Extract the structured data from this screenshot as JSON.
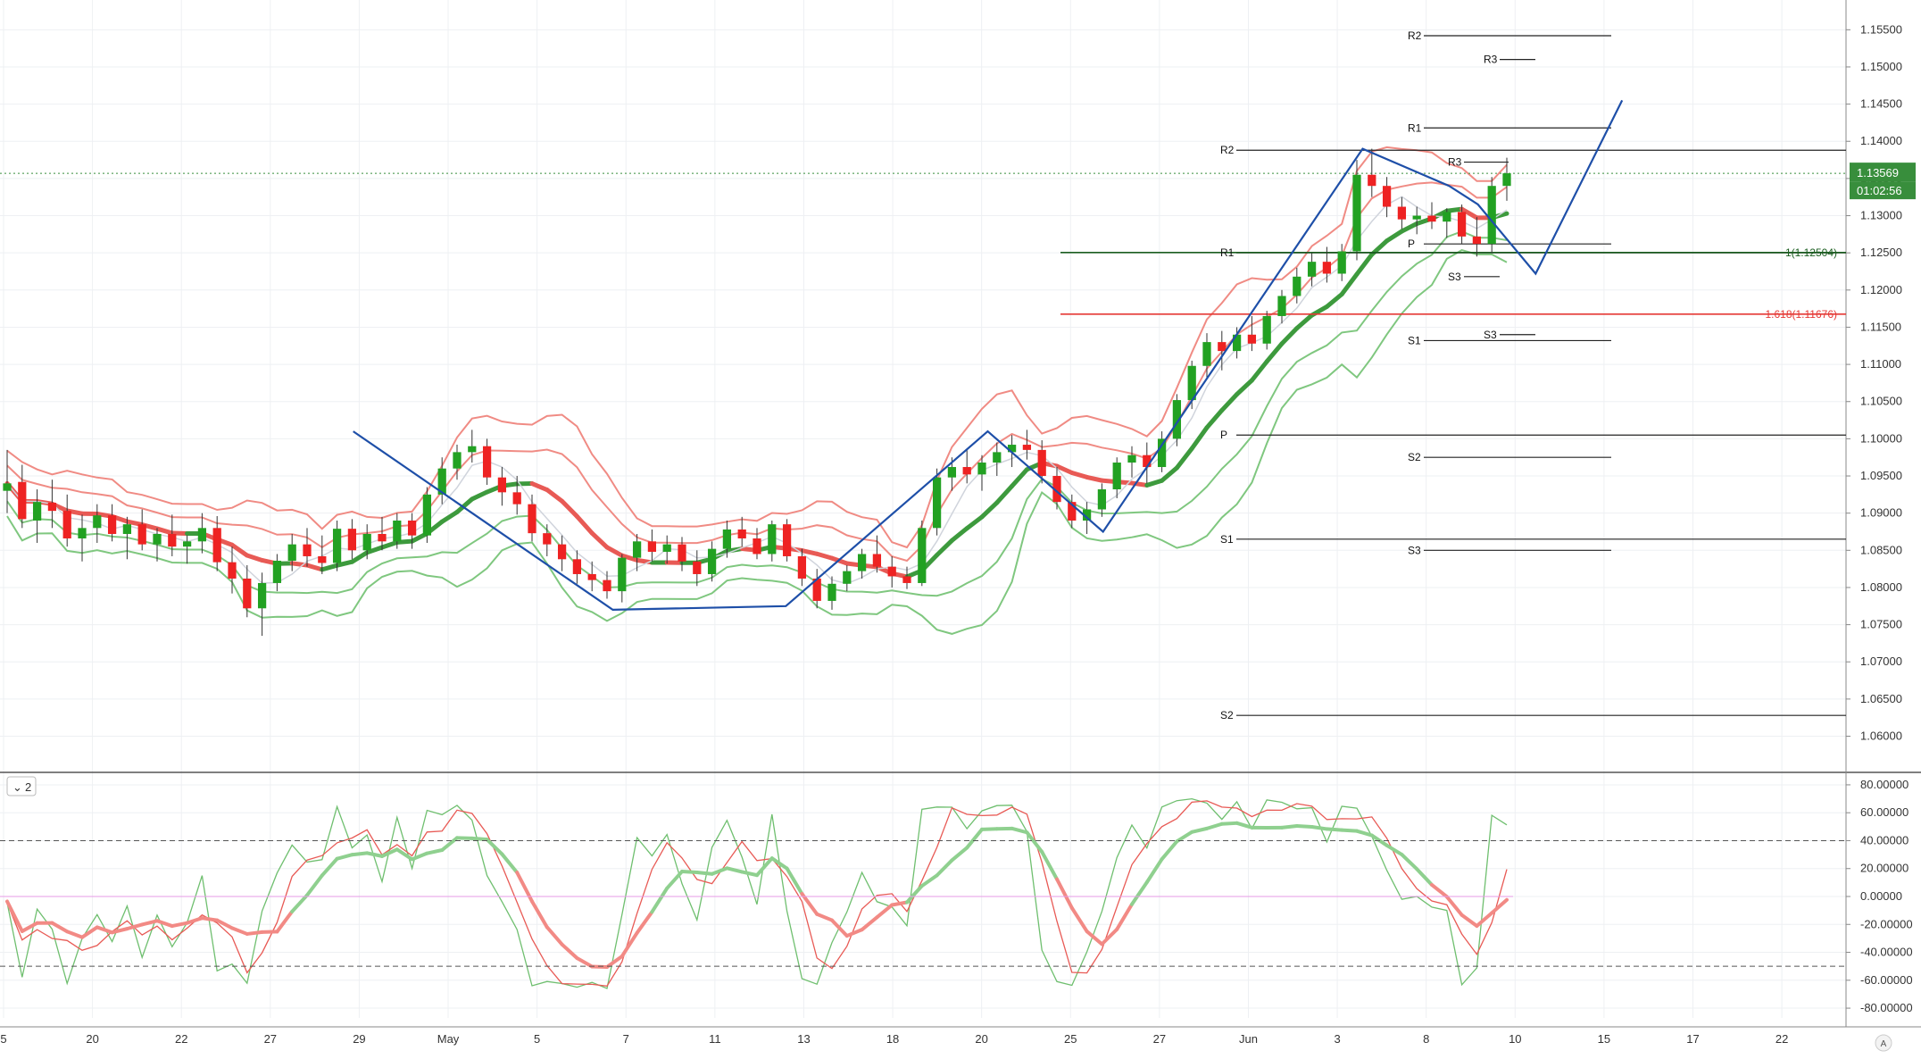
{
  "chart_data": {
    "type": "candlestick",
    "symbol_price": {
      "current_price": "1.13569",
      "countdown": "01:02:56",
      "price_color": "#388e3c",
      "value": 1.13569
    },
    "x_axis": {
      "tick_labels": [
        "5",
        "20",
        "22",
        "27",
        "29",
        "May",
        "5",
        "7",
        "11",
        "13",
        "18",
        "20",
        "25",
        "27",
        "Jun",
        "3",
        "8",
        "10",
        "15",
        "17",
        "22"
      ]
    },
    "price_pane": {
      "ylim": [
        1.0555,
        1.159
      ],
      "y_ticks": [
        1.06,
        1.065,
        1.07,
        1.075,
        1.08,
        1.085,
        1.09,
        1.095,
        1.1,
        1.105,
        1.11,
        1.115,
        1.12,
        1.125,
        1.13,
        1.135,
        1.14,
        1.145,
        1.15,
        1.155
      ],
      "y_tick_labels": [
        "1.06000",
        "1.06500",
        "1.07000",
        "1.07500",
        "1.08000",
        "1.08500",
        "1.09000",
        "1.09500",
        "1.10000",
        "1.10500",
        "1.11000",
        "1.11500",
        "1.12000",
        "1.12500",
        "1.13000",
        "1.13500",
        "1.14000",
        "1.14500",
        "1.15000",
        "1.15500"
      ],
      "candles": [
        {
          "o": 1.093,
          "h": 1.0985,
          "l": 1.09,
          "c": 1.094
        },
        {
          "o": 1.0942,
          "h": 1.0965,
          "l": 1.088,
          "c": 1.0892
        },
        {
          "o": 1.089,
          "h": 1.0932,
          "l": 1.086,
          "c": 1.0915
        },
        {
          "o": 1.0914,
          "h": 1.0945,
          "l": 1.088,
          "c": 1.0903
        },
        {
          "o": 1.0903,
          "h": 1.0925,
          "l": 1.0855,
          "c": 1.0866
        },
        {
          "o": 1.0866,
          "h": 1.0898,
          "l": 1.0835,
          "c": 1.088
        },
        {
          "o": 1.088,
          "h": 1.0912,
          "l": 1.086,
          "c": 1.0897
        },
        {
          "o": 1.0897,
          "h": 1.0912,
          "l": 1.0862,
          "c": 1.0872
        },
        {
          "o": 1.0872,
          "h": 1.0895,
          "l": 1.0838,
          "c": 1.0885
        },
        {
          "o": 1.0885,
          "h": 1.0905,
          "l": 1.085,
          "c": 1.0858
        },
        {
          "o": 1.0858,
          "h": 1.088,
          "l": 1.0835,
          "c": 1.0872
        },
        {
          "o": 1.0872,
          "h": 1.0898,
          "l": 1.0842,
          "c": 1.0855
        },
        {
          "o": 1.0855,
          "h": 1.087,
          "l": 1.0832,
          "c": 1.0862
        },
        {
          "o": 1.0862,
          "h": 1.09,
          "l": 1.0846,
          "c": 1.088
        },
        {
          "o": 1.088,
          "h": 1.0896,
          "l": 1.0822,
          "c": 1.0834
        },
        {
          "o": 1.0834,
          "h": 1.0855,
          "l": 1.0792,
          "c": 1.0812
        },
        {
          "o": 1.0812,
          "h": 1.083,
          "l": 1.076,
          "c": 1.0772
        },
        {
          "o": 1.0772,
          "h": 1.082,
          "l": 1.0735,
          "c": 1.0806
        },
        {
          "o": 1.0806,
          "h": 1.0845,
          "l": 1.0795,
          "c": 1.0836
        },
        {
          "o": 1.0836,
          "h": 1.0872,
          "l": 1.0822,
          "c": 1.0858
        },
        {
          "o": 1.0858,
          "h": 1.088,
          "l": 1.0828,
          "c": 1.0842
        },
        {
          "o": 1.0842,
          "h": 1.087,
          "l": 1.0818,
          "c": 1.0833
        },
        {
          "o": 1.0833,
          "h": 1.089,
          "l": 1.0822,
          "c": 1.0879
        },
        {
          "o": 1.0879,
          "h": 1.0892,
          "l": 1.0838,
          "c": 1.085
        },
        {
          "o": 1.085,
          "h": 1.0885,
          "l": 1.0838,
          "c": 1.0872
        },
        {
          "o": 1.0872,
          "h": 1.0895,
          "l": 1.085,
          "c": 1.0862
        },
        {
          "o": 1.0862,
          "h": 1.09,
          "l": 1.0852,
          "c": 1.089
        },
        {
          "o": 1.089,
          "h": 1.09,
          "l": 1.0852,
          "c": 1.087
        },
        {
          "o": 1.087,
          "h": 1.0935,
          "l": 1.086,
          "c": 1.0925
        },
        {
          "o": 1.0925,
          "h": 1.0975,
          "l": 1.0912,
          "c": 1.096
        },
        {
          "o": 1.096,
          "h": 1.0992,
          "l": 1.0945,
          "c": 1.0982
        },
        {
          "o": 1.0982,
          "h": 1.1012,
          "l": 1.0968,
          "c": 1.099
        },
        {
          "o": 1.099,
          "h": 1.1,
          "l": 1.0938,
          "c": 1.0948
        },
        {
          "o": 1.0948,
          "h": 1.0962,
          "l": 1.091,
          "c": 1.0928
        },
        {
          "o": 1.0928,
          "h": 1.095,
          "l": 1.0898,
          "c": 1.0912
        },
        {
          "o": 1.0912,
          "h": 1.0925,
          "l": 1.0862,
          "c": 1.0873
        },
        {
          "o": 1.0873,
          "h": 1.0885,
          "l": 1.0842,
          "c": 1.0858
        },
        {
          "o": 1.0858,
          "h": 1.087,
          "l": 1.0822,
          "c": 1.0838
        },
        {
          "o": 1.0838,
          "h": 1.085,
          "l": 1.0805,
          "c": 1.0818
        },
        {
          "o": 1.0818,
          "h": 1.0835,
          "l": 1.0795,
          "c": 1.081
        },
        {
          "o": 1.081,
          "h": 1.0822,
          "l": 1.0785,
          "c": 1.0795
        },
        {
          "o": 1.0795,
          "h": 1.0845,
          "l": 1.078,
          "c": 1.084
        },
        {
          "o": 1.084,
          "h": 1.0872,
          "l": 1.0822,
          "c": 1.0862
        },
        {
          "o": 1.0862,
          "h": 1.0878,
          "l": 1.0835,
          "c": 1.0848
        },
        {
          "o": 1.0848,
          "h": 1.087,
          "l": 1.0832,
          "c": 1.0858
        },
        {
          "o": 1.0858,
          "h": 1.0868,
          "l": 1.0822,
          "c": 1.0835
        },
        {
          "o": 1.0835,
          "h": 1.085,
          "l": 1.0802,
          "c": 1.0818
        },
        {
          "o": 1.0818,
          "h": 1.0862,
          "l": 1.0808,
          "c": 1.0852
        },
        {
          "o": 1.0852,
          "h": 1.089,
          "l": 1.084,
          "c": 1.0878
        },
        {
          "o": 1.0878,
          "h": 1.0895,
          "l": 1.0855,
          "c": 1.0866
        },
        {
          "o": 1.0866,
          "h": 1.088,
          "l": 1.0838,
          "c": 1.0845
        },
        {
          "o": 1.0845,
          "h": 1.089,
          "l": 1.0835,
          "c": 1.0885
        },
        {
          "o": 1.0885,
          "h": 1.0892,
          "l": 1.0835,
          "c": 1.0842
        },
        {
          "o": 1.0842,
          "h": 1.0852,
          "l": 1.0802,
          "c": 1.0812
        },
        {
          "o": 1.0812,
          "h": 1.0825,
          "l": 1.0772,
          "c": 1.0782
        },
        {
          "o": 1.0782,
          "h": 1.0815,
          "l": 1.077,
          "c": 1.0805
        },
        {
          "o": 1.0805,
          "h": 1.083,
          "l": 1.0795,
          "c": 1.0822
        },
        {
          "o": 1.0822,
          "h": 1.0852,
          "l": 1.0812,
          "c": 1.0845
        },
        {
          "o": 1.0845,
          "h": 1.087,
          "l": 1.082,
          "c": 1.0828
        },
        {
          "o": 1.0828,
          "h": 1.0842,
          "l": 1.08,
          "c": 1.0815
        },
        {
          "o": 1.0815,
          "h": 1.0828,
          "l": 1.0798,
          "c": 1.0806
        },
        {
          "o": 1.0806,
          "h": 1.089,
          "l": 1.0802,
          "c": 1.088
        },
        {
          "o": 1.088,
          "h": 1.096,
          "l": 1.087,
          "c": 1.0948
        },
        {
          "o": 1.0948,
          "h": 1.0975,
          "l": 1.093,
          "c": 1.0962
        },
        {
          "o": 1.0962,
          "h": 1.0985,
          "l": 1.094,
          "c": 1.0952
        },
        {
          "o": 1.0952,
          "h": 1.0978,
          "l": 1.093,
          "c": 1.0968
        },
        {
          "o": 1.0968,
          "h": 1.0995,
          "l": 1.095,
          "c": 1.0982
        },
        {
          "o": 1.0982,
          "h": 1.1005,
          "l": 1.0962,
          "c": 1.0992
        },
        {
          "o": 1.0992,
          "h": 1.1012,
          "l": 1.0972,
          "c": 1.0985
        },
        {
          "o": 1.0985,
          "h": 1.0998,
          "l": 1.094,
          "c": 1.095
        },
        {
          "o": 1.095,
          "h": 1.0962,
          "l": 1.0905,
          "c": 1.0915
        },
        {
          "o": 1.0915,
          "h": 1.0925,
          "l": 1.088,
          "c": 1.089
        },
        {
          "o": 1.089,
          "h": 1.0915,
          "l": 1.0872,
          "c": 1.0905
        },
        {
          "o": 1.0905,
          "h": 1.094,
          "l": 1.0895,
          "c": 1.0932
        },
        {
          "o": 1.0932,
          "h": 1.0975,
          "l": 1.092,
          "c": 1.0968
        },
        {
          "o": 1.0968,
          "h": 1.099,
          "l": 1.0948,
          "c": 1.0978
        },
        {
          "o": 1.0978,
          "h": 1.0995,
          "l": 1.094,
          "c": 1.0962
        },
        {
          "o": 1.0962,
          "h": 1.101,
          "l": 1.0955,
          "c": 1.1
        },
        {
          "o": 1.1,
          "h": 1.106,
          "l": 1.099,
          "c": 1.1052
        },
        {
          "o": 1.1052,
          "h": 1.1105,
          "l": 1.104,
          "c": 1.1098
        },
        {
          "o": 1.1098,
          "h": 1.1142,
          "l": 1.1082,
          "c": 1.113
        },
        {
          "o": 1.113,
          "h": 1.1145,
          "l": 1.1092,
          "c": 1.1118
        },
        {
          "o": 1.1118,
          "h": 1.115,
          "l": 1.1108,
          "c": 1.114
        },
        {
          "o": 1.114,
          "h": 1.1165,
          "l": 1.1118,
          "c": 1.1128
        },
        {
          "o": 1.1128,
          "h": 1.1172,
          "l": 1.112,
          "c": 1.1165
        },
        {
          "o": 1.1165,
          "h": 1.12,
          "l": 1.1155,
          "c": 1.1192
        },
        {
          "o": 1.1192,
          "h": 1.123,
          "l": 1.1182,
          "c": 1.1218
        },
        {
          "o": 1.1218,
          "h": 1.125,
          "l": 1.1205,
          "c": 1.1238
        },
        {
          "o": 1.1238,
          "h": 1.1258,
          "l": 1.121,
          "c": 1.1222
        },
        {
          "o": 1.1222,
          "h": 1.1262,
          "l": 1.1212,
          "c": 1.1252
        },
        {
          "o": 1.1252,
          "h": 1.1375,
          "l": 1.124,
          "c": 1.1355
        },
        {
          "o": 1.1355,
          "h": 1.139,
          "l": 1.1325,
          "c": 1.134
        },
        {
          "o": 1.134,
          "h": 1.1352,
          "l": 1.1298,
          "c": 1.1312
        },
        {
          "o": 1.1312,
          "h": 1.1325,
          "l": 1.1282,
          "c": 1.1295
        },
        {
          "o": 1.1295,
          "h": 1.1312,
          "l": 1.1275,
          "c": 1.13
        },
        {
          "o": 1.13,
          "h": 1.1318,
          "l": 1.1282,
          "c": 1.1292
        },
        {
          "o": 1.1292,
          "h": 1.131,
          "l": 1.127,
          "c": 1.1305
        },
        {
          "o": 1.1305,
          "h": 1.1315,
          "l": 1.1262,
          "c": 1.1272
        },
        {
          "o": 1.1272,
          "h": 1.1298,
          "l": 1.1245,
          "c": 1.1262
        },
        {
          "o": 1.1262,
          "h": 1.1352,
          "l": 1.125,
          "c": 1.134
        },
        {
          "o": 1.134,
          "h": 1.1378,
          "l": 1.132,
          "c": 1.1357
        }
      ],
      "pivot_levels_a": [
        {
          "label": "R2",
          "y": 1.1388
        },
        {
          "label": "R1",
          "y": 1.125
        },
        {
          "label": "P",
          "y": 1.1005
        },
        {
          "label": "S1",
          "y": 1.0865
        },
        {
          "label": "S2",
          "y": 1.0628
        }
      ],
      "pivot_levels_b": [
        {
          "label": "R2",
          "y": 1.1542
        },
        {
          "label": "R3",
          "y": 1.151
        },
        {
          "label": "R1",
          "y": 1.1418
        },
        {
          "label": "R3",
          "y": 1.1372
        },
        {
          "label": "P",
          "y": 1.1262
        },
        {
          "label": "S3",
          "y": 1.1218
        },
        {
          "label": "S3",
          "y": 1.114
        },
        {
          "label": "S1",
          "y": 1.1132
        },
        {
          "label": "S2",
          "y": 1.0975
        },
        {
          "label": "S3",
          "y": 1.085
        }
      ],
      "fib_levels": [
        {
          "label": "1(1.12504)",
          "y": 1.12504,
          "color": "#1b5e20"
        },
        {
          "label": "1.618(1.11676)",
          "y": 1.11676,
          "color": "#e53935"
        }
      ],
      "zigzag_points": [
        {
          "i": 12,
          "y": 1.101
        },
        {
          "i": 21,
          "y": 1.077
        },
        {
          "i": 27,
          "y": 1.0775
        },
        {
          "i": 34,
          "y": 1.101
        },
        {
          "i": 38,
          "y": 1.0875
        },
        {
          "i": 47,
          "y": 1.139
        },
        {
          "i": 50,
          "y": 1.134
        },
        {
          "i": 51,
          "y": 1.1315
        },
        {
          "i": 53,
          "y": 1.1222
        },
        {
          "i": 56,
          "y": 1.1455
        }
      ]
    },
    "oscillator_pane": {
      "badge": "2",
      "ylim": [
        -87,
        87
      ],
      "y_ticks": [
        -80,
        -60,
        -40,
        -20,
        0,
        20,
        40,
        60,
        80
      ],
      "y_tick_labels": [
        "-80.00000",
        "-60.00000",
        "-40.00000",
        "-20.00000",
        "0.00000",
        "20.00000",
        "40.00000",
        "60.00000",
        "80.00000"
      ],
      "levels": [
        40,
        -50,
        0
      ]
    },
    "colors": {
      "up": "#22a122",
      "down": "#ee2222",
      "band_red": "#f08b84",
      "band_green": "#7fc77f",
      "zigzag": "#1e4fa8",
      "grid": "#eef0f3"
    },
    "corner_letter": "A"
  }
}
